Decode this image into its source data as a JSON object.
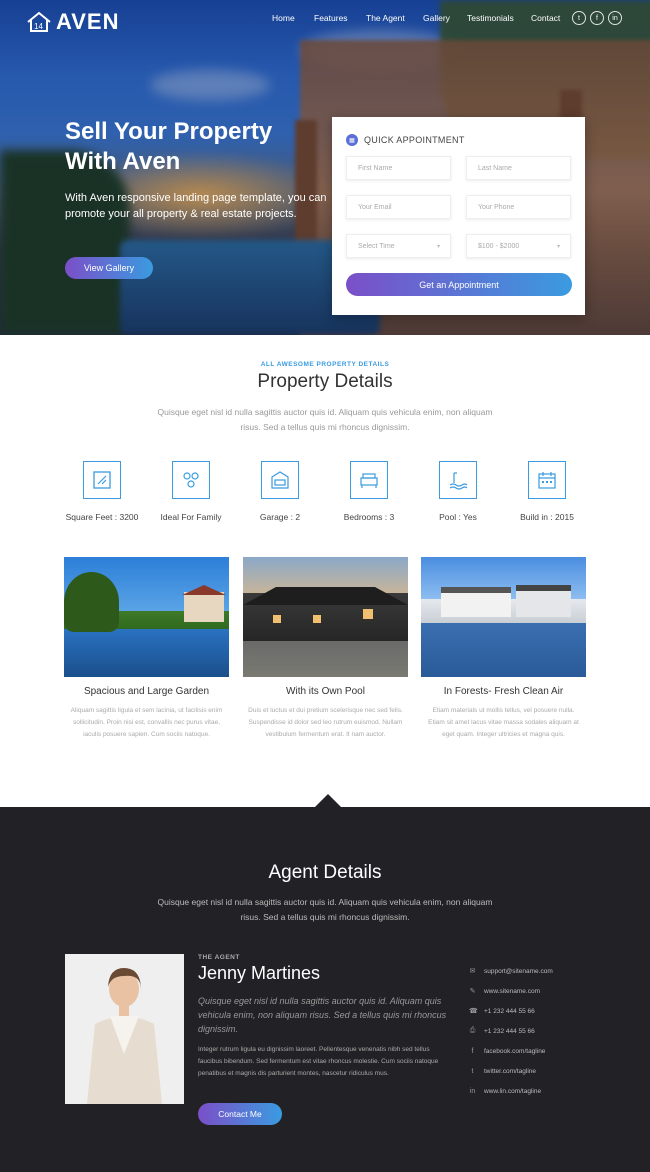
{
  "brand": {
    "name": "AVEN",
    "logo_icon": "house-logo-icon"
  },
  "nav": {
    "items": [
      "Home",
      "Features",
      "The Agent",
      "Gallery",
      "Testimonials",
      "Contact"
    ]
  },
  "social": {
    "twitter": "t",
    "facebook": "f",
    "linkedin": "in"
  },
  "hero": {
    "title_line1": "Sell Your Property",
    "title_line2": "With Aven",
    "text": "With Aven responsive landing page template, you can promote your all property & real estate projects.",
    "button": "View Gallery"
  },
  "appointment": {
    "title": "QUICK APPOINTMENT",
    "first_name": "First Name",
    "last_name": "Last Name",
    "email": "Your Email",
    "phone": "Your Phone",
    "time": "Select Time",
    "budget": "$100 - $2000",
    "button": "Get an Appointment"
  },
  "property": {
    "kicker": "ALL AWESOME PROPERTY DETAILS",
    "title": "Property Details",
    "desc": "Quisque eget nisl id nulla sagittis auctor quis id. Aliquam quis vehicula enim, non aliquam risus. Sed a tellus quis mi rhoncus dignissim.",
    "features": [
      {
        "label": "Square Feet : 3200",
        "icon": "area-measure-icon"
      },
      {
        "label": "Ideal For Family",
        "icon": "family-icon"
      },
      {
        "label": "Garage : 2",
        "icon": "garage-icon"
      },
      {
        "label": "Bedrooms : 3",
        "icon": "bed-icon"
      },
      {
        "label": "Pool : Yes",
        "icon": "pool-icon"
      },
      {
        "label": "Build in : 2015",
        "icon": "calendar-icon"
      }
    ],
    "cards": [
      {
        "title": "Spacious and Large Garden",
        "text": "Aliquam sagittis ligula et sem lacinia, ut facilisis enim sollicitudin. Proin nisi est, convallis nec purus vitae, iaculis posuere sapien. Cum sociis natoque."
      },
      {
        "title": "With its Own Pool",
        "text": "Duis et luctus et dui pretium scelerisque nec sed felis. Suspendisse id dolor sed leo rutrum euismod. Nullam vestibulum fermentum erat. It nam auctor."
      },
      {
        "title": "In Forests- Fresh Clean Air",
        "text": "Etiam materials ut mollis tellus, vel posuere nulla. Etiam sit amet lacus vitae massa sodales aliquam at eget quam. Integer ultricies et magna quis."
      }
    ]
  },
  "agent": {
    "title": "Agent Details",
    "desc": "Quisque eget nisl id nulla sagittis auctor quis id. Aliquam quis vehicula enim, non aliquam risus. Sed a tellus quis mi rhoncus dignissim.",
    "kicker": "THE AGENT",
    "name": "Jenny Martines",
    "quote": "Quisque eget nisl id nulla sagittis auctor quis id. Aliquam quis vehicula enim, non aliquam risus. Sed a tellus quis mi rhoncus dignissim.",
    "bio": "Integer rutrum ligula eu dignissim laoreet. Pellentesque venenatis nibh sed tellus faucibus bibendum. Sed fermentum est vitae rhoncus molestie. Cum sociis natoque penatibus et magnis dis parturient montes, nascetur ridiculus mus.",
    "button": "Contact Me",
    "contacts": [
      {
        "icon": "mail-icon",
        "glyph": "✉",
        "text": "support@sitename.com"
      },
      {
        "icon": "link-icon",
        "glyph": "✎",
        "text": "www.sitename.com"
      },
      {
        "icon": "phone-icon",
        "glyph": "☎",
        "text": "+1 232 444 55 66"
      },
      {
        "icon": "fax-icon",
        "glyph": "⎙",
        "text": "+1 232 444 55 66"
      },
      {
        "icon": "facebook-icon",
        "glyph": "f",
        "text": "facebook.com/tagline"
      },
      {
        "icon": "twitter-icon",
        "glyph": "t",
        "text": "twitter.com/tagline"
      },
      {
        "icon": "linkedin-icon",
        "glyph": "in",
        "text": "www.lin.com/tagline"
      }
    ]
  }
}
